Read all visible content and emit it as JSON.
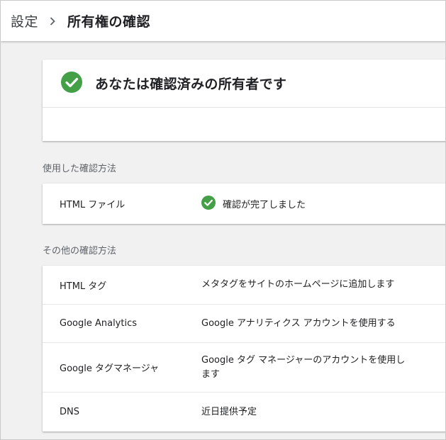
{
  "breadcrumb": {
    "root": "設定",
    "current": "所有権の確認"
  },
  "owner": {
    "title": "あなたは確認済みの所有者です"
  },
  "used_methods": {
    "label": "使用した確認方法",
    "rows": [
      {
        "name": "HTML ファイル",
        "status": "確認が完了しました"
      }
    ]
  },
  "other_methods": {
    "label": "その他の確認方法",
    "rows": [
      {
        "name": "HTML タグ",
        "description": "メタタグをサイトのホームページに追加します"
      },
      {
        "name": "Google Analytics",
        "description": "Google アナリティクス アカウントを使用する"
      },
      {
        "name": "Google タグマネージャ",
        "description": "Google タグ マネージャーのアカウントを使用します"
      },
      {
        "name": "DNS",
        "description": "近日提供予定"
      }
    ]
  },
  "icons": {
    "check": "check-circle-icon",
    "separator": "chevron-right-icon"
  },
  "colors": {
    "success": "#43a047",
    "background": "#f1f1f1",
    "card": "#ffffff"
  }
}
